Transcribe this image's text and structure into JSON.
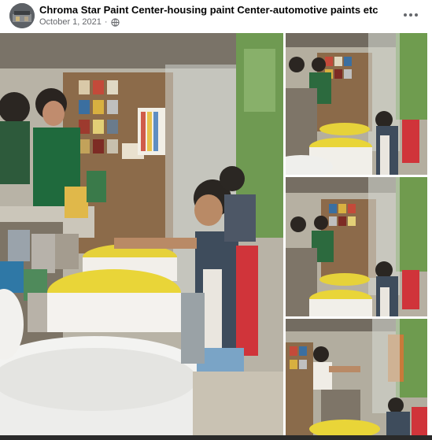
{
  "post": {
    "page_name": "Chroma Star Paint Center-housing paint Center-automotive paints etc",
    "date": "October 1, 2021",
    "separator": "·",
    "privacy_icon": "globe-icon",
    "more_icon": "more-options-icon"
  },
  "photos": [
    {
      "name": "photo-main"
    },
    {
      "name": "photo-thumb-1"
    },
    {
      "name": "photo-thumb-2"
    },
    {
      "name": "photo-thumb-3"
    }
  ]
}
